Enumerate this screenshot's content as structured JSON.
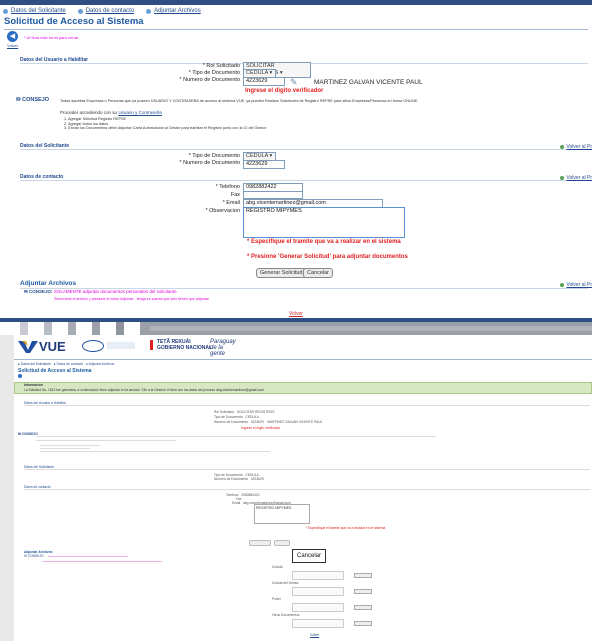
{
  "top": {
    "tabs": [
      "Datos del Solicitante",
      "Datos de contacto",
      "Adjuntar Archivos"
    ],
    "title": "Solicitud de Acceso al Sistema",
    "back_label": "Volver",
    "required_note": "* Ul tima este formi para cerrar",
    "user_section": {
      "title": "Datos del Usuario a Habilitar",
      "rol_label": "* Rol Solicitado",
      "rol_value": "SOLICITAR REGISTROS",
      "tipo_doc_label": "* Tipo de Documento",
      "tipo_doc_value": "CEDULA",
      "num_doc_label": "* Numero de Documento",
      "num_doc_value": "4223629",
      "person_name": "MARTINEZ GALVAN VICENTE PAUL",
      "verif_msg": "Ingrese el digito verificador"
    },
    "consejo": {
      "title": "CONSEJO",
      "text": "Todas aquellas Empresas o Personas que ya poseen USUARIO Y CONTRASEÑA de acceso al sistema VUE, ya pueden Realizar Solicitudes de Registro REPSE para sitios Empresas/Personas en forma ONLINE",
      "proceed": "Proceder accediendo con su",
      "proceed_link": "Usuario y Contraseña",
      "steps": [
        "1. Agregar Solicitud Registro REPSE",
        "2. Agregar todos los datos",
        "3. Enviar los Documentos debe Adjuntar Carta Autorización al Gestor para tramitar el Registro junto con la CI del Gestor"
      ]
    },
    "solicitante_section": {
      "title": "Datos del Solicitante",
      "tipo_doc_label": "* Tipo de Documento",
      "tipo_doc_value": "CEDULA",
      "num_doc_label": "* Numero de Documento",
      "num_doc_value": "4223629"
    },
    "contacto_section": {
      "title": "Datos de contacto",
      "telefono_label": "* Telefono",
      "telefono_value": "0982882422",
      "fax_label": "Fax",
      "email_label": "* Email",
      "email_value": "abg.vicentemartinez@gmail.com",
      "obs_label": "* Observacion",
      "obs_value": "REGISTRO MIPYMES",
      "msg_tramite": "* Especifique el tramite que va a realizar en el sistema",
      "msg_generar": "* Presione 'Generar Solicitud' para adjuntar documentos"
    },
    "buttons": {
      "generar": "Generar Solicitud",
      "cancelar": "Cancelar"
    },
    "adjuntar": {
      "title": "Adjuntar Archivos",
      "consejo": "CONSEJO:",
      "consejo_text": "SOLAMENTE adjuntar documentos personales del solicitante",
      "pink_text": "Seleccione el archivo y presione el botón Adjuntar - tenga en cuenta que solo tienen que adjuntar"
    },
    "volver_pr": "Volver al Pr",
    "volver_bottom": "Volver"
  },
  "bottom": {
    "logo_vue": "VUE",
    "gov1": "TETÃ REKUÁI",
    "gov2": "GOBIERNO NACIONAL",
    "script_text": "Paraguay de la gente",
    "title": "Solicitud de Acceso al Sistema",
    "info_label": "Informacion",
    "info_text": "La Solicitud No. 1813 fue generada, a continuación favor adjuntar en la sección 'Clic a la Gestion' el item con los datos del proceso abg.vicentemartinez@gmail.com",
    "cancel_popup": "Cancelar",
    "person_name": "MARTINEZ GALVAN VICENTE PAUL",
    "email_value": "abg.vicentemartinez@gmail.com",
    "obs_value": "REGISTRO MIPYMES",
    "attach_groups": [
      "Cedula",
      "Cedula del Gestor",
      "Poder",
      "Otros Documentos"
    ],
    "attach_button": "Adjuntar",
    "volver": "Volver"
  }
}
